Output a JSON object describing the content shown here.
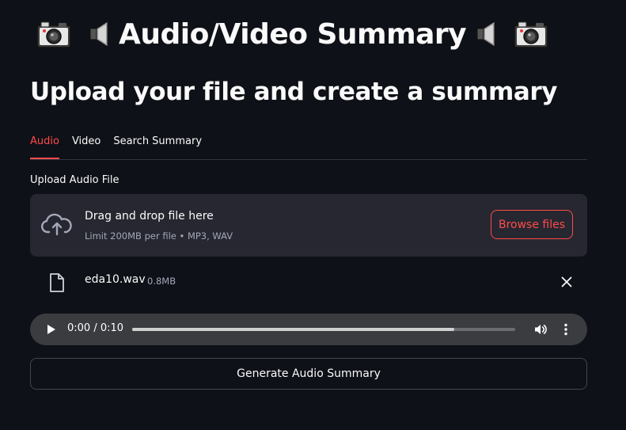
{
  "header": {
    "title": "Audio/Video Summary",
    "left_icons": [
      "camera-icon",
      "speaker-icon"
    ],
    "right_icons": [
      "speaker-icon",
      "camera-icon"
    ]
  },
  "subtitle": "Upload your file and create a summary",
  "tabs": [
    {
      "label": "Audio",
      "active": true
    },
    {
      "label": "Video",
      "active": false
    },
    {
      "label": "Search Summary",
      "active": false
    }
  ],
  "uploader": {
    "label": "Upload Audio File",
    "drop_title": "Drag and drop file here",
    "limit_text": "Limit 200MB per file • MP3, WAV",
    "browse_label": "Browse files",
    "icon": "cloud-upload-icon"
  },
  "file": {
    "name": "eda10.wav",
    "size": "0.8MB",
    "icon": "file-icon"
  },
  "player": {
    "time": "0:00 / 0:10",
    "progress": 0.84
  },
  "actions": {
    "generate_label": "Generate Audio Summary"
  },
  "colors": {
    "background": "#0e1117",
    "accent": "#ff4b4b",
    "panel": "#262730",
    "player": "#3b3c40",
    "muted_text": "#a3a8b8"
  }
}
